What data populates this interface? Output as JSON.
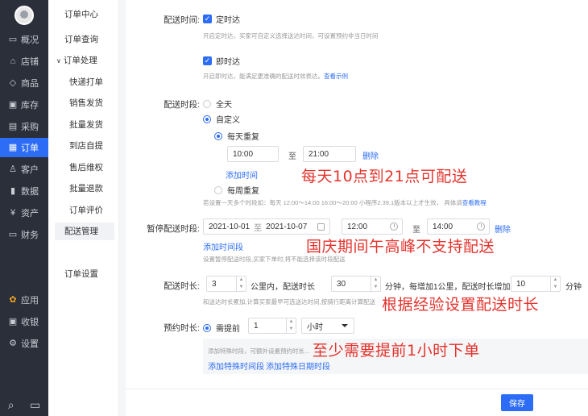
{
  "rail": {
    "items": [
      {
        "label": "概况",
        "icon": "chart-icon"
      },
      {
        "label": "店铺",
        "icon": "store-icon"
      },
      {
        "label": "商品",
        "icon": "tag-icon"
      },
      {
        "label": "库存",
        "icon": "warehouse-icon"
      },
      {
        "label": "采购",
        "icon": "cart-icon"
      },
      {
        "label": "订单",
        "icon": "order-icon"
      },
      {
        "label": "客户",
        "icon": "user-icon"
      },
      {
        "label": "数据",
        "icon": "bar-chart-icon"
      },
      {
        "label": "资产",
        "icon": "yen-icon"
      },
      {
        "label": "财务",
        "icon": "wallet-icon"
      },
      {
        "label": "应用",
        "icon": "apps-icon"
      },
      {
        "label": "收银",
        "icon": "cashier-icon"
      },
      {
        "label": "设置",
        "icon": "gear-icon"
      }
    ],
    "active_index": 5
  },
  "menu2": {
    "title": "订单中心",
    "query": "订单查询",
    "group": "订单处理",
    "items": [
      "快递打单",
      "销售发货",
      "批量发货",
      "到店自提",
      "售后维权",
      "批量退款",
      "订单评价",
      "配送管理"
    ],
    "selected": "配送管理",
    "settings": "订单设置"
  },
  "form": {
    "delivery_time_label": "配送时间:",
    "scheduled_label": "定时达",
    "scheduled_hint": "开启定时达，买家可自定义选择送达时间，可设置预约非当日时间",
    "instant_label": "即时达",
    "instant_hint": "开启即时达，能满足更准确的配送时效表达。",
    "instant_hint_link": "查看示例",
    "period_label": "配送时段:",
    "all_day": "全天",
    "custom": "自定义",
    "daily_repeat": "每天重复",
    "start_time": "10:00",
    "to": "至",
    "end_time": "21:00",
    "delete": "删除",
    "add_time": "添加时间",
    "weekly_repeat": "每周重复",
    "period_hint": "若设置一天多个时段如：每天 12:00～14:00 16:00～20:00 小程序2.39.1版本以上才生效， 具体请",
    "period_hint_link": "查看教程",
    "pause_label": "暂停配送时段:",
    "pause_start_date": "2021-10-01",
    "pause_end_date": "2021-10-07",
    "pause_start_time": "12:00",
    "pause_end_time": "14:00",
    "add_time_period": "添加时间段",
    "pause_hint": "设置暂停配送时段,买家下单时,将不能选择该时段配送",
    "duration_label": "配送时长:",
    "duration_km": "3",
    "duration_text1": "公里内，配送时长",
    "duration_min": "30",
    "duration_text2": "分钟，每增加1公里，配送时长增加",
    "duration_inc": "10",
    "duration_text3": "分钟",
    "duration_hint": "和送达时长累加,计算买家最早可选送达时间,按骑行距离计算配送",
    "advance_label": "预约时长:",
    "advance_need": "需提前",
    "advance_value": "1",
    "advance_unit": "小时",
    "advance_hint": "添加特殊时段，可额外设置预约时长...",
    "add_special_period": "添加特殊时间段",
    "add_special_date": "添加特殊日期时段",
    "save": "保存"
  },
  "annotations": {
    "a1": "每天10点到21点可配送",
    "a2": "国庆期间午高峰不支持配送",
    "a3": "根据经验设置配送时长",
    "a4": "至少需要提前1小时下单"
  },
  "colors": {
    "accent": "#2d6df6",
    "rail": "#2b2f3a",
    "annotation": "#e4332c"
  }
}
